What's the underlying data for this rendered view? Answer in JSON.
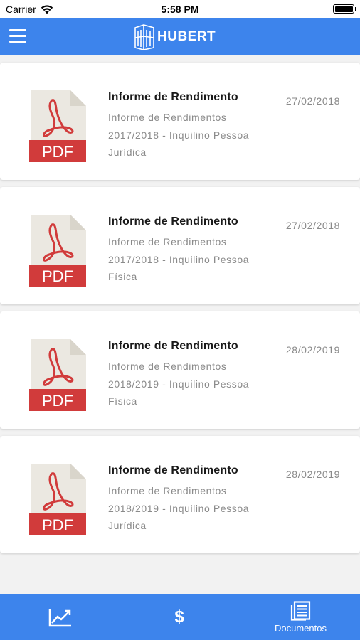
{
  "status_bar": {
    "carrier": "Carrier",
    "time": "5:58 PM",
    "battery_level": 1.0
  },
  "header": {
    "app_name": "HUBERT",
    "menu_icon": "hamburger-menu-icon",
    "logo_icon": "building-logo-icon",
    "background_color": "#3d84ec"
  },
  "documents": [
    {
      "title": "Informe de Rendimento",
      "description": "Informe de Rendimentos 2017/2018 - Inquilino Pessoa Jurídica",
      "date": "27/02/2018",
      "file_type": "PDF"
    },
    {
      "title": "Informe de Rendimento",
      "description": "Informe de Rendimentos 2017/2018 - Inquilino Pessoa Física",
      "date": "27/02/2018",
      "file_type": "PDF"
    },
    {
      "title": "Informe de Rendimento",
      "description": "Informe de Rendimentos 2018/2019 - Inquilino Pessoa Física",
      "date": "28/02/2019",
      "file_type": "PDF"
    },
    {
      "title": "Informe de Rendimento",
      "description": "Informe de Rendimentos 2018/2019 - Inquilino Pessoa Jurídica",
      "date": "28/02/2019",
      "file_type": "PDF"
    }
  ],
  "tab_bar": {
    "tabs": [
      {
        "icon": "line-chart-icon",
        "label": ""
      },
      {
        "icon": "dollar-icon",
        "label": "$"
      },
      {
        "icon": "documents-icon",
        "label": "Documentos"
      }
    ],
    "active_tab": "Documentos",
    "background_color": "#3d84ec"
  },
  "colors": {
    "accent": "#3d84ec",
    "pdf_red": "#d13b3b",
    "pdf_page": "#ebe8e1"
  }
}
